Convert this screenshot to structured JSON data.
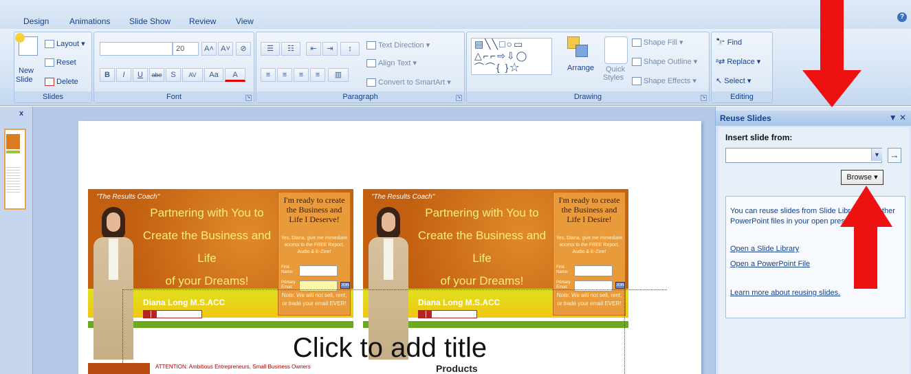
{
  "tabs": [
    "Design",
    "Animations",
    "Slide Show",
    "Review",
    "View"
  ],
  "help_glyph": "?",
  "ribbon": {
    "slides": {
      "new_label": "New",
      "new_sub": "Slide",
      "layout": "Layout",
      "reset": "Reset",
      "delete": "Delete",
      "group": "Slides"
    },
    "font": {
      "size": "20",
      "bold": "B",
      "italic": "I",
      "underline": "U",
      "strike": "abe",
      "shadow": "S",
      "spacing": "AV",
      "case": "Aa",
      "color": "A",
      "grow": "A˄",
      "shrink": "A˅",
      "group": "Font"
    },
    "paragraph": {
      "text_direction": "Text Direction",
      "align_text": "Align Text",
      "convert": "Convert to SmartArt",
      "group": "Paragraph"
    },
    "drawing": {
      "arrange": "Arrange",
      "quick": "Quick",
      "styles": "Styles",
      "fill": "Shape Fill",
      "outline": "Shape Outline",
      "effects": "Shape Effects",
      "group": "Drawing"
    },
    "editing": {
      "find": "Find",
      "replace": "Replace",
      "select": "Select",
      "group": "Editing"
    }
  },
  "left_panel": {
    "close": "x"
  },
  "slide": {
    "banners": [
      {
        "coach": "\"The Results Coach\"",
        "headline": [
          "Partnering with You to",
          "Create the Business and Life",
          "of your Dreams!"
        ],
        "ready": "I'm ready to create the Business and Life I Deserve!",
        "yes": "Yes, Diana, give me immediate access to the FREE Report, Audio & E-Zine!",
        "first": "First Name:",
        "primary": "Primary Email:",
        "join": "JOIN",
        "note": "Note: We will not sell, rent, or trade your email EVER!",
        "name": "Diana Long M.S.ACC"
      },
      {
        "coach": "\"The Results Coach\"",
        "headline": [
          "Partnering with You to",
          "Create the Business and Life",
          "of your Dreams!"
        ],
        "ready": "I'm ready to create the Business and Life I Desire!",
        "yes": "Yes, Diana, give me immediate access to the FREE Report, Audio & E-Zine!",
        "first": "First Name:",
        "primary": "Primary Email:",
        "join": "JOIN",
        "note": "Note: We will not sell, rent, or trade your email EVER!",
        "name": "Diana Long M.S.ACC"
      }
    ],
    "title_placeholder": "Click to add title",
    "attention": "ATTENTION: Ambitious Entrepreneurs, Small Business Owners",
    "products": "Products"
  },
  "pane": {
    "title": "Reuse Slides",
    "controls": "▼ ✕",
    "insert_label": "Insert slide from:",
    "combo_value": "",
    "go": "→",
    "browse": "Browse ▾",
    "info": "You can reuse slides from Slide Libraries or other PowerPoint files in your open presentation.",
    "link_library": "Open a Slide Library",
    "link_file": "Open a PowerPoint File",
    "link_learn": "Learn more about reusing slides."
  },
  "colors": {
    "ribbon": "#d2e2f4",
    "accent": "#15428b",
    "arrow": "#ee1111",
    "banner_orange": "#c25f10"
  }
}
